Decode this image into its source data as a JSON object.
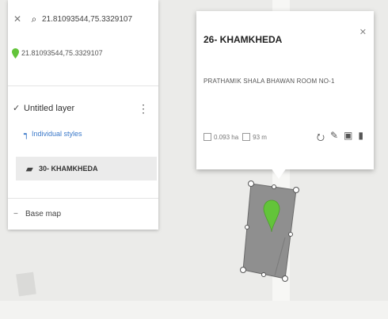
{
  "search": {
    "coords": "21.81093544,75.3329107"
  },
  "marker_row": {
    "coords": "21.81093544,75.3329107"
  },
  "layer": {
    "name": "Untitled layer",
    "styles_label": "Individual styles"
  },
  "feature": {
    "label": "30- KHAMKHEDA"
  },
  "basemap": {
    "label": "Base map"
  },
  "popup": {
    "title": "26- KHAMKHEDA",
    "description": "PRATHAMIK SHALA BHAWAN ROOM NO-1",
    "area": "0.093 ha",
    "perimeter": "93 m"
  },
  "colors": {
    "parcel_fill": "#8f8f8f",
    "pin_green": "#63c43a",
    "link_blue": "#3a78c9"
  }
}
